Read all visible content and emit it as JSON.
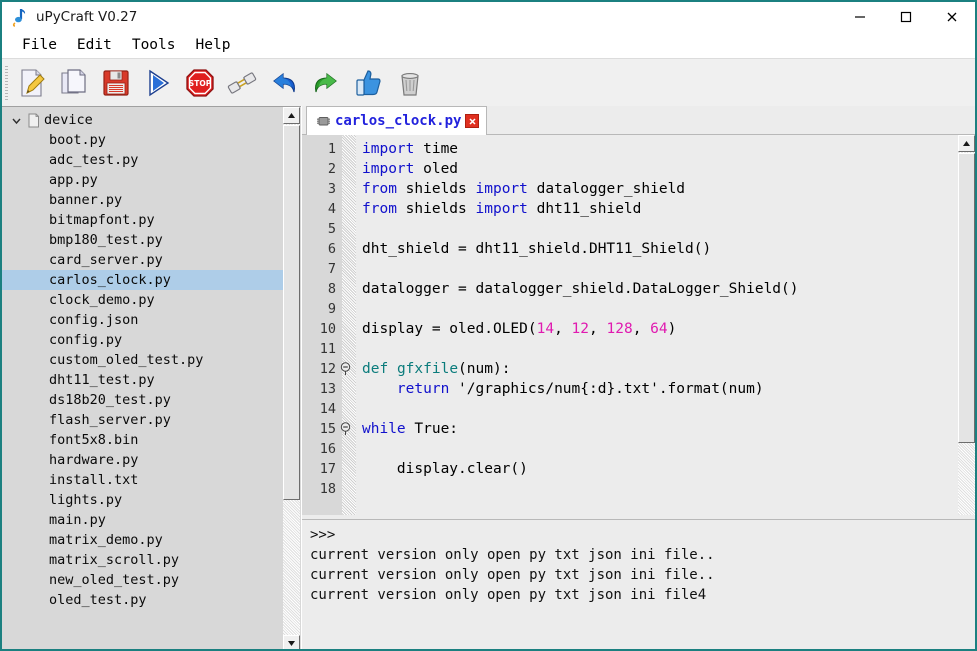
{
  "window": {
    "title": "uPyCraft V0.27",
    "logo_icon": "upycraft-logo-icon",
    "minimize_label": "—",
    "maximize_label": "□",
    "close_label": "✕",
    "border_color": "#1b8080"
  },
  "menu": {
    "items": [
      {
        "label": "File"
      },
      {
        "label": "Edit"
      },
      {
        "label": "Tools"
      },
      {
        "label": "Help"
      }
    ]
  },
  "toolbar": {
    "buttons": [
      {
        "icon": "new-file-icon",
        "label": "New file"
      },
      {
        "icon": "open-file-icon",
        "label": "Open file"
      },
      {
        "icon": "save-floppy-icon",
        "label": "Save"
      },
      {
        "icon": "run-play-icon",
        "label": "Run"
      },
      {
        "icon": "stop-sign-icon",
        "label": "Stop"
      },
      {
        "icon": "connect-plug-icon",
        "label": "Connect"
      },
      {
        "icon": "undo-arrow-icon",
        "label": "Undo"
      },
      {
        "icon": "redo-arrow-icon",
        "label": "Redo"
      },
      {
        "icon": "thumbs-up-icon",
        "label": "Download and run"
      },
      {
        "icon": "trash-bin-icon",
        "label": "Clear"
      }
    ]
  },
  "sidebar": {
    "root": {
      "label": "device",
      "icon": "device-folder-icon",
      "expanded": true
    },
    "selected": "carlos_clock.py",
    "selection_color": "#aecde8",
    "items": [
      {
        "label": "boot.py"
      },
      {
        "label": "adc_test.py"
      },
      {
        "label": "app.py"
      },
      {
        "label": "banner.py"
      },
      {
        "label": "bitmapfont.py"
      },
      {
        "label": "bmp180_test.py"
      },
      {
        "label": "card_server.py"
      },
      {
        "label": "carlos_clock.py"
      },
      {
        "label": "clock_demo.py"
      },
      {
        "label": "config.json"
      },
      {
        "label": "config.py"
      },
      {
        "label": "custom_oled_test.py"
      },
      {
        "label": "dht11_test.py"
      },
      {
        "label": "ds18b20_test.py"
      },
      {
        "label": "flash_server.py"
      },
      {
        "label": "font5x8.bin"
      },
      {
        "label": "hardware.py"
      },
      {
        "label": "install.txt"
      },
      {
        "label": "lights.py"
      },
      {
        "label": "main.py"
      },
      {
        "label": "matrix_demo.py"
      },
      {
        "label": "matrix_scroll.py"
      },
      {
        "label": "new_oled_test.py"
      },
      {
        "label": "oled_test.py"
      }
    ]
  },
  "editor": {
    "tab": {
      "label": "carlos_clock.py",
      "icon": "chip-icon",
      "close_icon": "close-icon",
      "label_color": "#2222dd"
    },
    "lines": [
      {
        "n": "1",
        "fold": "",
        "tokens": [
          {
            "t": "import",
            "c": "kw"
          },
          {
            "t": " time",
            "c": ""
          }
        ]
      },
      {
        "n": "2",
        "fold": "",
        "tokens": [
          {
            "t": "import",
            "c": "kw"
          },
          {
            "t": " oled",
            "c": ""
          }
        ]
      },
      {
        "n": "3",
        "fold": "",
        "tokens": [
          {
            "t": "from",
            "c": "kw"
          },
          {
            "t": " shields ",
            "c": ""
          },
          {
            "t": "import",
            "c": "kw"
          },
          {
            "t": " datalogger_shield",
            "c": ""
          }
        ]
      },
      {
        "n": "4",
        "fold": "",
        "tokens": [
          {
            "t": "from",
            "c": "kw"
          },
          {
            "t": " shields ",
            "c": ""
          },
          {
            "t": "import",
            "c": "kw"
          },
          {
            "t": " dht11_shield",
            "c": ""
          }
        ]
      },
      {
        "n": "5",
        "fold": "",
        "tokens": []
      },
      {
        "n": "6",
        "fold": "",
        "tokens": [
          {
            "t": "dht_shield = dht11_shield.DHT11_Shield()",
            "c": ""
          }
        ]
      },
      {
        "n": "7",
        "fold": "",
        "tokens": []
      },
      {
        "n": "8",
        "fold": "",
        "tokens": [
          {
            "t": "datalogger = datalogger_shield.DataLogger_Shield()",
            "c": ""
          }
        ]
      },
      {
        "n": "9",
        "fold": "",
        "tokens": []
      },
      {
        "n": "10",
        "fold": "",
        "tokens": [
          {
            "t": "display = oled.OLED(",
            "c": ""
          },
          {
            "t": "14",
            "c": "num"
          },
          {
            "t": ", ",
            "c": ""
          },
          {
            "t": "12",
            "c": "num"
          },
          {
            "t": ", ",
            "c": ""
          },
          {
            "t": "128",
            "c": "num"
          },
          {
            "t": ", ",
            "c": ""
          },
          {
            "t": "64",
            "c": "num"
          },
          {
            "t": ")",
            "c": ""
          }
        ]
      },
      {
        "n": "11",
        "fold": "",
        "tokens": []
      },
      {
        "n": "12",
        "fold": "minus",
        "tokens": [
          {
            "t": "def",
            "c": "kw2"
          },
          {
            "t": " ",
            "c": ""
          },
          {
            "t": "gfxfile",
            "c": "fn"
          },
          {
            "t": "(num):",
            "c": ""
          }
        ]
      },
      {
        "n": "13",
        "fold": "",
        "tokens": [
          {
            "t": "    ",
            "c": ""
          },
          {
            "t": "return",
            "c": "kw"
          },
          {
            "t": " '/graphics/num{:d}.txt'.format(num)",
            "c": ""
          }
        ]
      },
      {
        "n": "14",
        "fold": "",
        "tokens": []
      },
      {
        "n": "15",
        "fold": "minus",
        "tokens": [
          {
            "t": "while",
            "c": "kw"
          },
          {
            "t": " True:",
            "c": ""
          }
        ]
      },
      {
        "n": "16",
        "fold": "",
        "tokens": []
      },
      {
        "n": "17",
        "fold": "",
        "tokens": [
          {
            "t": "    display.clear()",
            "c": ""
          }
        ]
      },
      {
        "n": "18",
        "fold": "",
        "tokens": []
      }
    ]
  },
  "console": {
    "lines": [
      ">>>",
      "current version only open py txt json ini file..",
      "current version only open py txt json ini file..",
      "current version only open py txt json ini file4"
    ]
  },
  "scrollbars": {
    "tree_up_icon": "scroll-up-arrow-icon",
    "tree_down_icon": "scroll-down-arrow-icon",
    "editor_up_icon": "scroll-up-arrow-icon",
    "editor_down_icon": "scroll-down-arrow-icon",
    "editor_left_icon": "scroll-left-arrow-icon",
    "editor_right_icon": "scroll-right-arrow-icon"
  }
}
